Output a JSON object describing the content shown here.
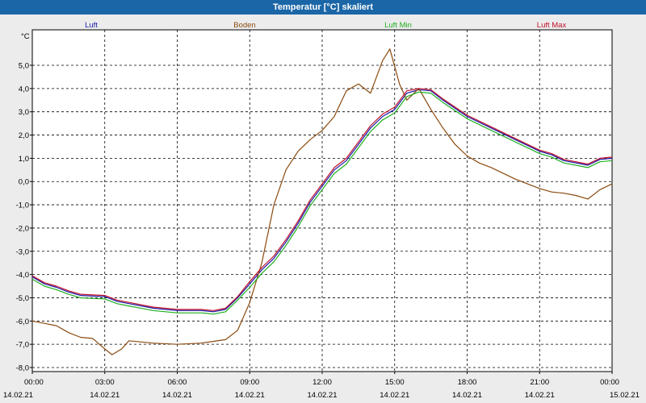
{
  "window": {
    "title": "Temperatur [°C] skaliert"
  },
  "chart_data": {
    "type": "line",
    "title": "Temperatur [°C] skaliert",
    "ylabel": "°C",
    "ylim": [
      -8.2,
      6.2
    ],
    "yticks": [
      5.0,
      4.0,
      3.0,
      2.0,
      1.0,
      0.0,
      -1.0,
      -2.0,
      -3.0,
      -4.0,
      -5.0,
      -6.0,
      -7.0,
      -8.0
    ],
    "ytick_labels": [
      "5,0",
      "4,0",
      "3,0",
      "2,0",
      "1,0",
      "0,0",
      "-1,0",
      "-2,0",
      "-3,0",
      "-4,0",
      "-5,0",
      "-6,0",
      "-7,0",
      "-8,0"
    ],
    "xlim": [
      0,
      24
    ],
    "xticks": [
      {
        "h": 0,
        "time": "00:00",
        "date": "14.02.21"
      },
      {
        "h": 3,
        "time": "03:00",
        "date": "14.02.21"
      },
      {
        "h": 6,
        "time": "06:00",
        "date": "14.02.21"
      },
      {
        "h": 9,
        "time": "09:00",
        "date": "14.02.21"
      },
      {
        "h": 12,
        "time": "12:00",
        "date": "14.02.21"
      },
      {
        "h": 15,
        "time": "15:00",
        "date": "14.02.21"
      },
      {
        "h": 18,
        "time": "18:00",
        "date": "14.02.21"
      },
      {
        "h": 21,
        "time": "21:00",
        "date": "14.02.21"
      },
      {
        "h": 24,
        "time": "00:00",
        "date": "15.02.21"
      }
    ],
    "grid": true,
    "legend_position": "top",
    "series": [
      {
        "name": "Luft",
        "color": "#1a1aa8",
        "x": [
          0,
          0.5,
          1,
          1.5,
          2,
          3,
          3.5,
          4,
          5,
          6,
          7,
          7.5,
          8,
          8.5,
          9,
          9.5,
          10,
          10.5,
          11,
          11.5,
          12,
          12.5,
          13,
          13.5,
          14,
          14.5,
          15,
          15.5,
          16,
          16.5,
          17,
          18,
          19,
          20,
          21,
          21.5,
          22,
          23,
          23.5,
          24
        ],
        "y": [
          -4.1,
          -4.4,
          -4.55,
          -4.75,
          -4.9,
          -4.95,
          -5.15,
          -5.25,
          -5.45,
          -5.55,
          -5.55,
          -5.6,
          -5.5,
          -5.0,
          -4.4,
          -3.8,
          -3.3,
          -2.6,
          -1.8,
          -0.9,
          -0.2,
          0.5,
          0.9,
          1.6,
          2.3,
          2.8,
          3.1,
          3.8,
          3.95,
          3.9,
          3.5,
          2.8,
          2.3,
          1.8,
          1.3,
          1.15,
          0.9,
          0.7,
          0.95,
          1.0
        ]
      },
      {
        "name": "Boden",
        "color": "#8b4a0e",
        "x": [
          0,
          0.5,
          1,
          1.5,
          2,
          2.5,
          3,
          3.3,
          3.7,
          4,
          5,
          6,
          7,
          8,
          8.5,
          9,
          9.5,
          10,
          10.5,
          11,
          11.5,
          12,
          12.5,
          13,
          13.5,
          14,
          14.5,
          14.8,
          15.2,
          15.5,
          16,
          16.5,
          17,
          17.5,
          18,
          18.5,
          19,
          20,
          21,
          21.5,
          22,
          22.5,
          23,
          23.5,
          24
        ],
        "y": [
          -6.0,
          -6.1,
          -6.2,
          -6.5,
          -6.7,
          -6.75,
          -7.2,
          -7.45,
          -7.2,
          -6.85,
          -6.95,
          -7.0,
          -6.95,
          -6.8,
          -6.4,
          -5.2,
          -3.5,
          -1.0,
          0.5,
          1.3,
          1.8,
          2.2,
          2.8,
          3.9,
          4.2,
          3.8,
          5.2,
          5.7,
          4.2,
          3.5,
          4.0,
          3.1,
          2.3,
          1.6,
          1.1,
          0.8,
          0.6,
          0.1,
          -0.3,
          -0.45,
          -0.5,
          -0.6,
          -0.75,
          -0.35,
          -0.1
        ]
      },
      {
        "name": "Luft Min",
        "color": "#1fae1f",
        "x": [
          0,
          0.5,
          1,
          1.5,
          2,
          3,
          3.5,
          4,
          5,
          6,
          7,
          7.5,
          8,
          8.5,
          9,
          9.5,
          10,
          10.5,
          11,
          11.5,
          12,
          12.5,
          13,
          13.5,
          14,
          14.5,
          15,
          15.5,
          16,
          16.5,
          17,
          18,
          19,
          20,
          21,
          21.5,
          22,
          23,
          23.5,
          24
        ],
        "y": [
          -4.2,
          -4.5,
          -4.65,
          -4.85,
          -5.0,
          -5.05,
          -5.25,
          -5.35,
          -5.55,
          -5.65,
          -5.65,
          -5.7,
          -5.6,
          -5.1,
          -4.55,
          -3.95,
          -3.45,
          -2.75,
          -1.95,
          -1.05,
          -0.35,
          0.35,
          0.75,
          1.45,
          2.15,
          2.65,
          2.95,
          3.65,
          3.85,
          3.8,
          3.4,
          2.7,
          2.2,
          1.7,
          1.2,
          1.05,
          0.8,
          0.6,
          0.85,
          0.9
        ]
      },
      {
        "name": "Luft Max",
        "color": "#c0102a",
        "x": [
          0,
          0.5,
          1,
          1.5,
          2,
          3,
          3.5,
          4,
          5,
          6,
          7,
          7.5,
          8,
          8.5,
          9,
          9.5,
          10,
          10.5,
          11,
          11.5,
          12,
          12.5,
          13,
          13.5,
          14,
          14.5,
          15,
          15.5,
          16,
          16.5,
          17,
          18,
          19,
          20,
          21,
          21.5,
          22,
          23,
          23.5,
          24
        ],
        "y": [
          -4.05,
          -4.35,
          -4.5,
          -4.7,
          -4.85,
          -4.9,
          -5.1,
          -5.2,
          -5.4,
          -5.5,
          -5.5,
          -5.55,
          -5.45,
          -4.95,
          -4.3,
          -3.7,
          -3.2,
          -2.5,
          -1.7,
          -0.8,
          -0.1,
          0.6,
          1.0,
          1.7,
          2.4,
          2.9,
          3.2,
          3.9,
          4.0,
          3.95,
          3.55,
          2.85,
          2.35,
          1.85,
          1.35,
          1.2,
          0.95,
          0.75,
          1.0,
          1.05
        ]
      }
    ]
  }
}
